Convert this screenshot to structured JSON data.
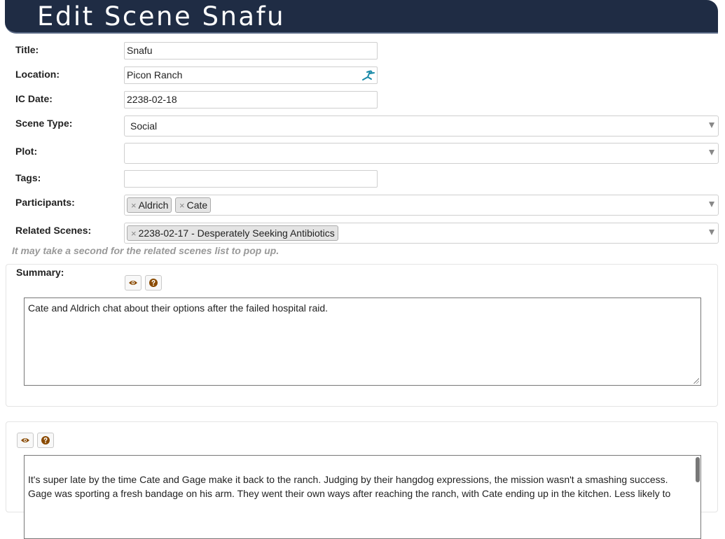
{
  "page": {
    "title": "Edit Scene Snafu"
  },
  "form": {
    "title_label": "Title:",
    "title_value": "Snafu",
    "location_label": "Location:",
    "location_value": "Picon Ranch",
    "icdate_label": "IC Date:",
    "icdate_value": "2238-02-18",
    "scenetype_label": "Scene Type:",
    "scenetype_value": "Social",
    "plot_label": "Plot:",
    "plot_value": "",
    "tags_label": "Tags:",
    "tags_value": "",
    "participants_label": "Participants:",
    "participants": [
      "Aldrich",
      "Cate"
    ],
    "related_label": "Related Scenes:",
    "related": [
      "2238-02-17 - Desperately Seeking Antibiotics"
    ],
    "remove_glyph": "×",
    "hint": "It may take a second for the related scenes list to pop up."
  },
  "summary": {
    "label": "Summary:",
    "text": "Cate and Aldrich chat about their options after the failed hospital raid."
  },
  "log": {
    "line1": "It's super late by the time Cate and Gage make it back to the ranch.  Judging by their hangdog expressions, the mission wasn't a smashing success.",
    "line2": "Gage was sporting a fresh bandage on his arm.  They went their own ways after reaching the ranch, with Cate ending up in the kitchen.  Less likely to"
  },
  "icons": {
    "location_picker": "running-figure-icon",
    "preview": "eye-icon",
    "help": "question-circle-icon"
  },
  "colors": {
    "title_bar": "#1f2c44",
    "toolbar_icon": "#8a4a00",
    "location_icon": "#1a8aa8"
  }
}
